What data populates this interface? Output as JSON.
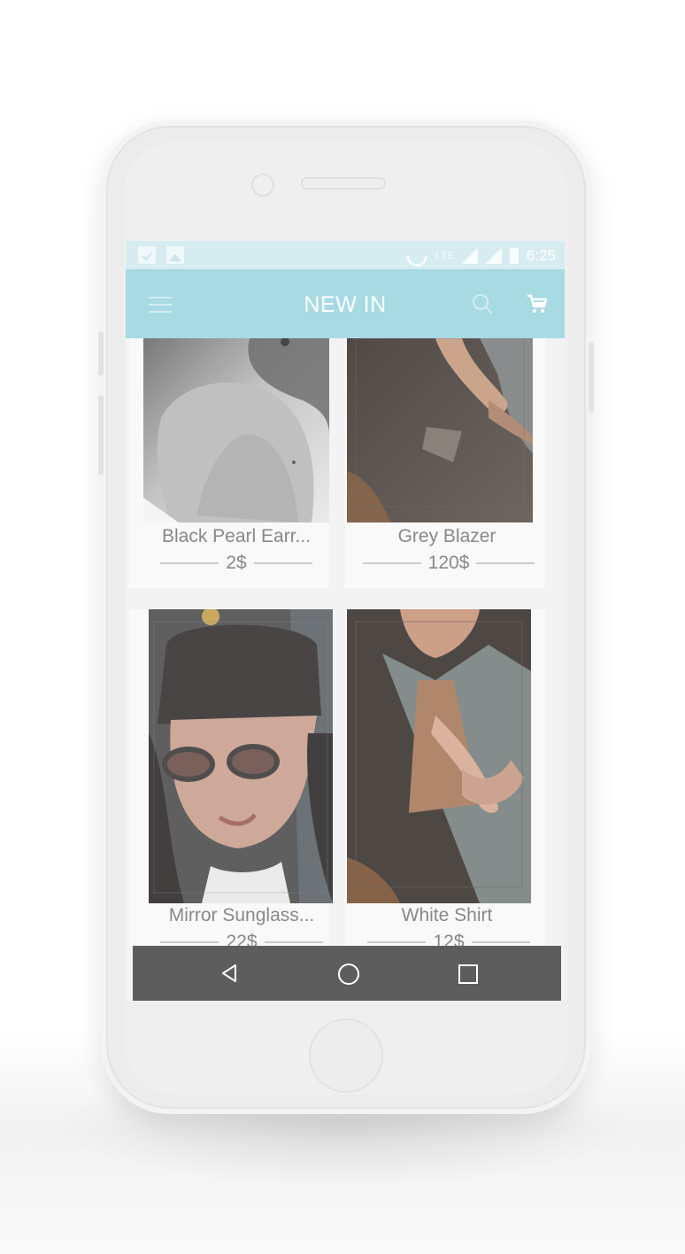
{
  "status_bar": {
    "network": "LTE",
    "time": "6:25"
  },
  "app_bar": {
    "title": "NEW IN",
    "menu_icon": "menu-icon",
    "search_icon": "search-icon",
    "cart_icon": "cart-icon"
  },
  "products": [
    {
      "name": "Black Pearl Earr...",
      "price": "2$"
    },
    {
      "name": "Grey Blazer",
      "price": "120$"
    },
    {
      "name": "Mirror Sunglass...",
      "price": "22$"
    },
    {
      "name": "White Shirt",
      "price": "12$"
    }
  ],
  "nav_bar": {
    "back_icon": "back-triangle-icon",
    "home_icon": "home-circle-icon",
    "recents_icon": "recents-square-icon"
  },
  "colors": {
    "app_bar": "#9fd6e1",
    "status_bar": "#d3eaef",
    "nav_bar": "#4b4b4b",
    "text": "#7b7b7b"
  }
}
